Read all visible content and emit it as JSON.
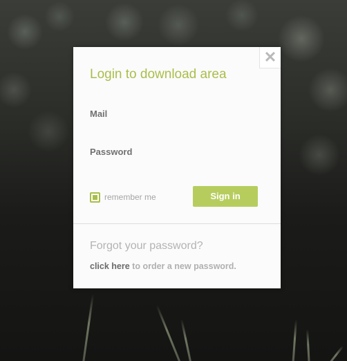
{
  "modal": {
    "title": "Login to download area",
    "close_symbol": "✕",
    "close_icon": "close-icon"
  },
  "form": {
    "mail": {
      "label": "Mail",
      "value": ""
    },
    "password": {
      "label": "Password",
      "value": ""
    },
    "remember": {
      "label": "remember me",
      "checked": true
    },
    "signin_label": "Sign in"
  },
  "forgot": {
    "title": "Forgot your password?",
    "link_text": "click here",
    "rest_text": "to order a new password."
  },
  "colors": {
    "accent": "#a9be4a",
    "button": "#b6cd5e",
    "muted_text": "#b3b3b3",
    "label_text": "#707070"
  }
}
